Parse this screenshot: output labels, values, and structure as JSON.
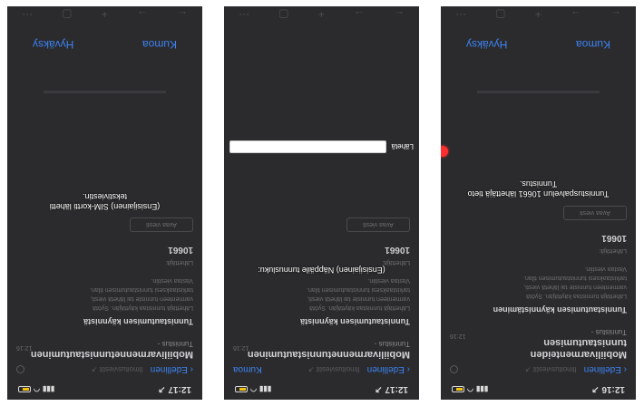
{
  "phones": [
    {
      "status": {
        "time": "12:16 ↗"
      },
      "nav": {
        "back": "Edellinen",
        "title": "Ilmoitusviestit ↗",
        "right": ""
      },
      "thread": {
        "title": "Mobiilivarmenteiden tunnistautumisen",
        "time": "12:16",
        "label": "Tunnistus -",
        "subtitle": "Tunnistautumisen käynnistäminen",
        "lines": [
          "Lähettäjä tunnistaa käyttäjän. Syötä",
          "varmenteen tunniste tai lähetä viesti,",
          "tarkistaaksesi tunnistautumisen tilan.",
          "Vastaa viestiin."
        ],
        "sender": "Lähettäjä:",
        "number": "10661",
        "button": "Avaa viesti"
      },
      "overlay": [
        "Tunnistuspalvelun 10661 lähettäjä tieto",
        "Tunnistus."
      ],
      "footer": {
        "left": "Kumoa",
        "right": "Hyväksy"
      }
    },
    {
      "status": {
        "time": "12:17 ↗"
      },
      "nav": {
        "back": "Edellinen",
        "title": "Ilmoitusviestit ↗",
        "right": "Kumoa"
      },
      "thread": {
        "title": "Mobiilivarmennetunnistautuminen",
        "time": "12:16",
        "label": "Tunnistus -",
        "subtitle": "Tunnistautumisen käynnistä",
        "lines": [
          "Lähettäjä tunnistaa käyttäjän. Syötä",
          "varmenteen tunniste tai lähetä viesti,",
          "tarkistaaksesi tunnistautumisen tilan.",
          "Vastaa viestiin."
        ],
        "sender": "Lähettäjä:",
        "number": "10661",
        "button": "Avaa viesti"
      },
      "overlay": [
        "(Ensisijainen) Näppäile tunnusluku:"
      ],
      "input": {
        "label": "Lähetä",
        "value": ""
      },
      "footer": {
        "left": "",
        "right": ""
      }
    },
    {
      "status": {
        "time": "12:17 ↗"
      },
      "nav": {
        "back": "Edellinen",
        "title": "Ilmoitusviestit ↗",
        "right": ""
      },
      "thread": {
        "title": "Mobiilivarmennetunnistautuminen",
        "time": "12:16",
        "label": "Tunnistus -",
        "subtitle": "Tunnistautumisen käynnistä",
        "lines": [
          "Lähettäjä tunnistaa käyttäjän. Syötä",
          "varmenteen tunniste tai lähetä viesti,",
          "tarkistaaksesi tunnistautumisen tilan.",
          "Vastaa viestiin."
        ],
        "sender": "Lähettäjä:",
        "number": "10661",
        "button": "Avaa viesti"
      },
      "overlay": [
        "(Ensisijainen) SIM-kortti lähetti",
        "tekstiviestin."
      ],
      "footer": {
        "left": "Kumoa",
        "right": "Hyväksy"
      }
    }
  ]
}
